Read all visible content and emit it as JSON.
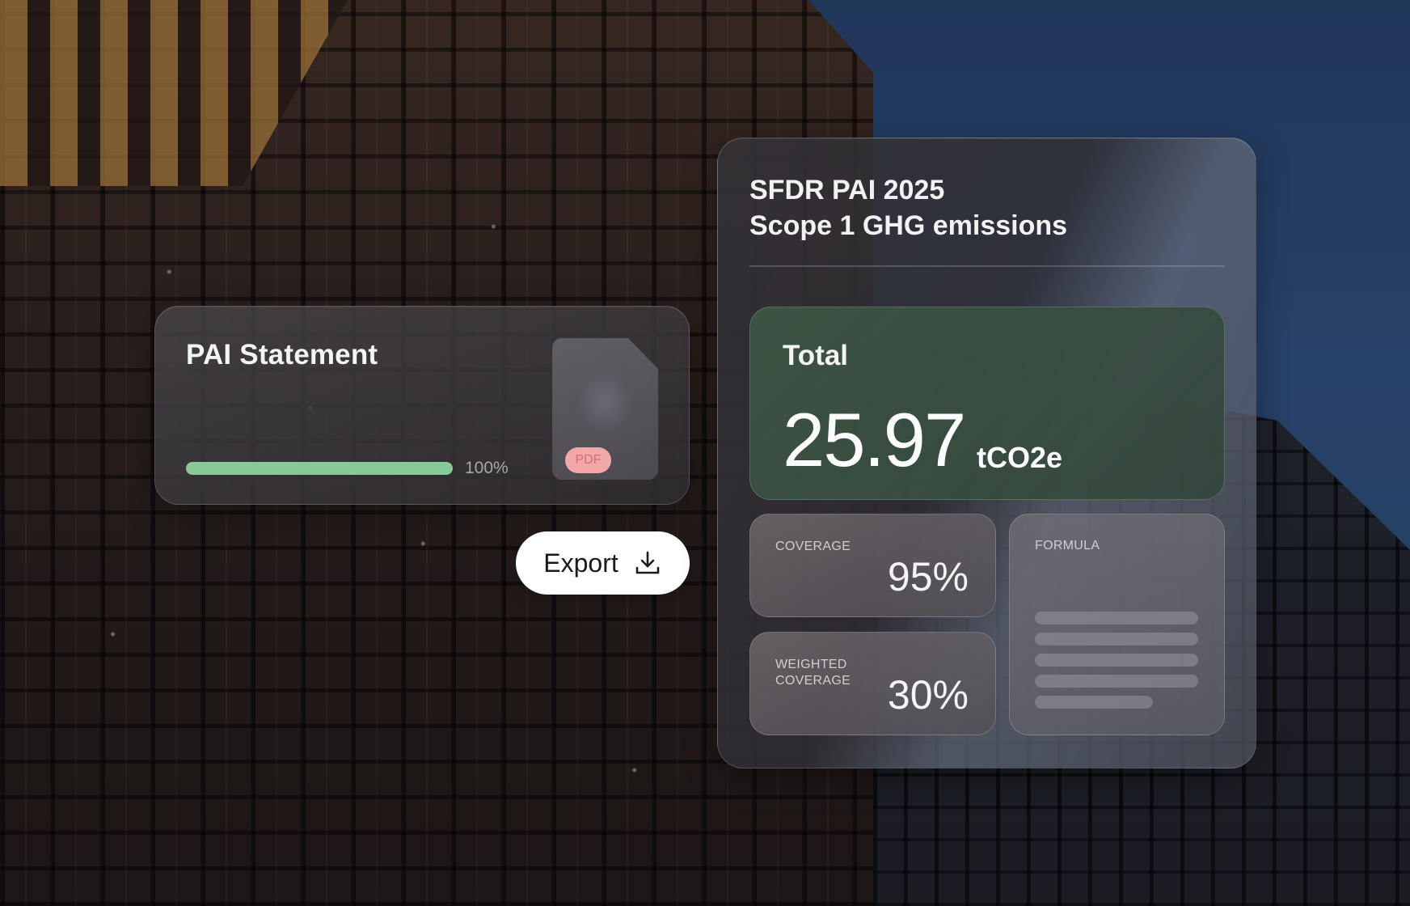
{
  "pai_card": {
    "title": "PAI Statement",
    "progress_percent": 100,
    "progress_label": "100%",
    "file_badge": "PDF"
  },
  "export": {
    "label": "Export",
    "icon": "download-icon"
  },
  "sfdr_card": {
    "title_line1": "SFDR PAI 2025",
    "title_line2": "Scope 1 GHG emissions",
    "total": {
      "label": "Total",
      "value": "25.97",
      "unit": "tCO2e"
    },
    "coverage": {
      "label": "COVERAGE",
      "value": "95%"
    },
    "weighted_coverage": {
      "label": "WEIGHTED COVERAGE",
      "value": "30%"
    },
    "formula": {
      "label": "FORMULA"
    }
  },
  "colors": {
    "progress": "#88c99a",
    "pdf_badge": "#f2a8a6",
    "total_card": "#3e5646"
  }
}
